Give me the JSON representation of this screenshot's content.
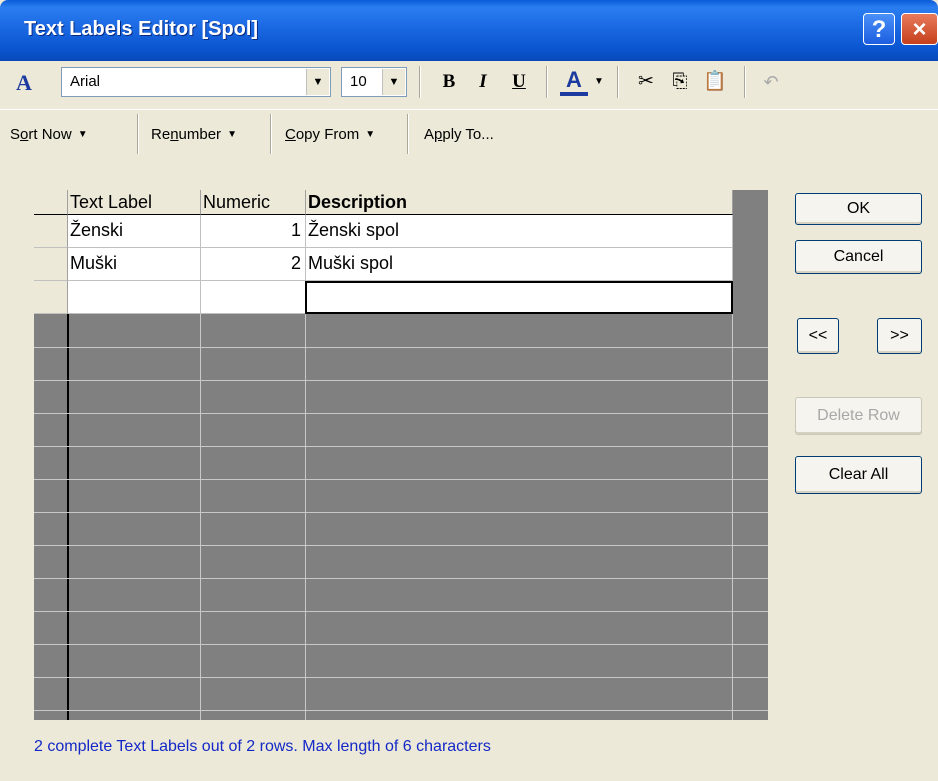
{
  "window": {
    "title": "Text Labels Editor [Spol]",
    "help_label": "?",
    "close_label": "×"
  },
  "format_toolbar": {
    "font_icon": "A",
    "font_name": "Arial",
    "font_size": "10",
    "bold_label": "B",
    "italic_label": "I",
    "underline_label": "U",
    "font_color_label": "A",
    "icons": [
      "font-icon",
      "bold-icon",
      "italic-icon",
      "underline-icon",
      "font-color-icon",
      "cut-icon",
      "copy-icon",
      "paste-icon",
      "undo-icon"
    ]
  },
  "command_toolbar": {
    "sort_pre": "S",
    "sort_u": "o",
    "sort_post": "rt Now",
    "renumber_pre": "Re",
    "renumber_u": "n",
    "renumber_post": "umber",
    "copy_u": "C",
    "copy_post": "opy From",
    "apply_pre": "A",
    "apply_u": "p",
    "apply_post": "ply To..."
  },
  "grid": {
    "headers": [
      "Text Label",
      "Numeric",
      "Description"
    ],
    "rows": [
      {
        "label": "Ženski",
        "numeric": "1",
        "description": "Ženski spol"
      },
      {
        "label": "Muški",
        "numeric": "2",
        "description": "Muški spol"
      },
      {
        "label": "",
        "numeric": "",
        "description": ""
      }
    ]
  },
  "buttons": {
    "ok": "OK",
    "cancel": "Cancel",
    "prev": "<<",
    "next": ">>",
    "delete_row": "Delete Row",
    "clear_all": "Clear All"
  },
  "status_text": "2 complete Text Labels out of 2 rows. Max length of 6 characters",
  "colors": {
    "title_bar": "#0a55d0",
    "dialog_bg": "#ece9d8",
    "grid_bg": "#808080",
    "status_text": "#1428c8"
  }
}
